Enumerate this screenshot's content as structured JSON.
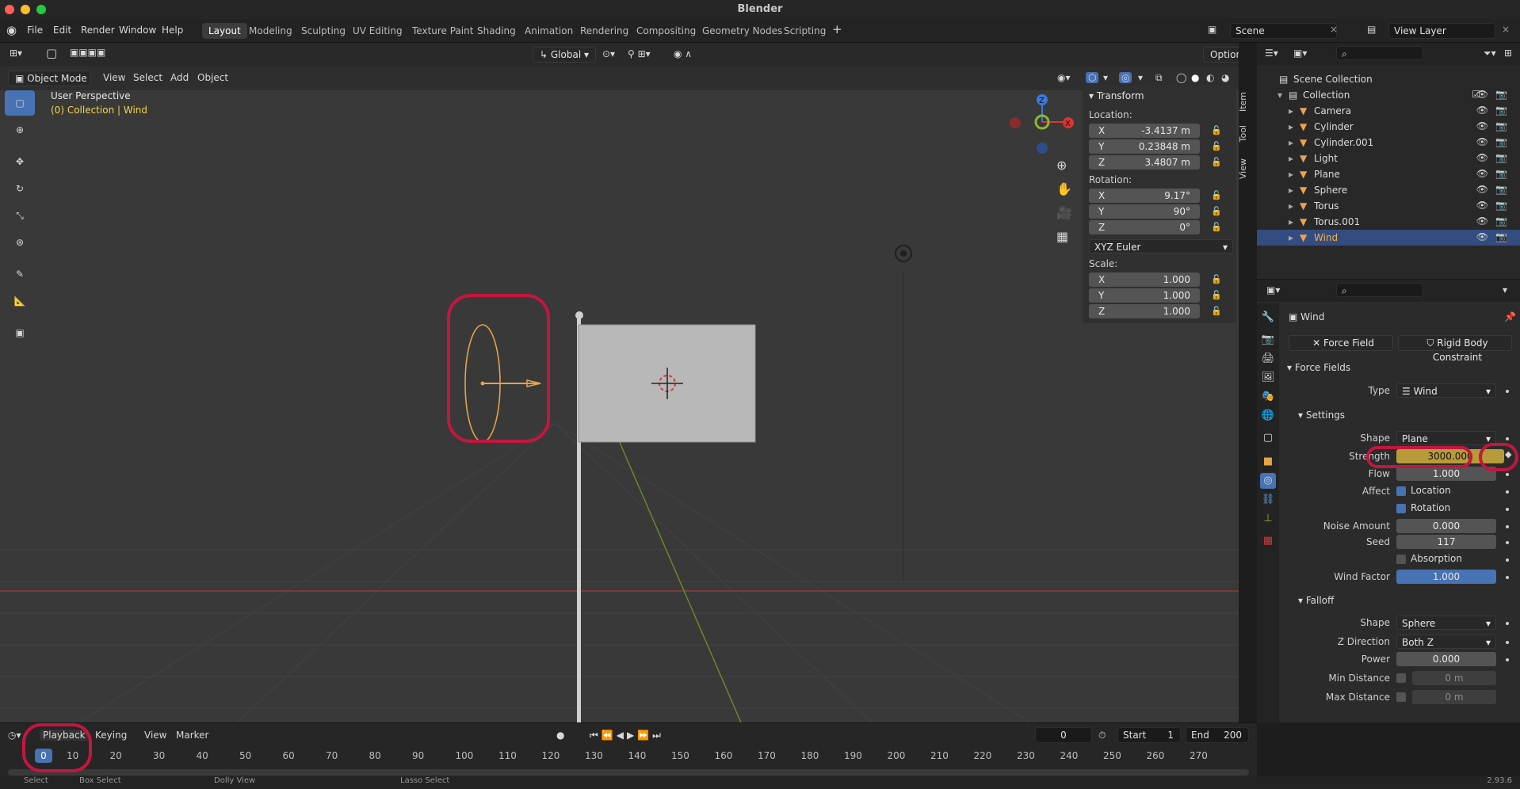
{
  "window": {
    "title": "Blender"
  },
  "menu": [
    "File",
    "Edit",
    "Render",
    "Window",
    "Help"
  ],
  "workspaces": [
    {
      "label": "Layout",
      "active": true
    },
    {
      "label": "Modeling",
      "active": false
    },
    {
      "label": "Sculpting",
      "active": false
    },
    {
      "label": "UV Editing",
      "active": false
    },
    {
      "label": "Texture Paint",
      "active": false
    },
    {
      "label": "Shading",
      "active": false
    },
    {
      "label": "Animation",
      "active": false
    },
    {
      "label": "Rendering",
      "active": false
    },
    {
      "label": "Compositing",
      "active": false
    },
    {
      "label": "Geometry Nodes",
      "active": false
    },
    {
      "label": "Scripting",
      "active": false
    }
  ],
  "scene": {
    "name": "Scene",
    "view_layer": "View Layer"
  },
  "viewport": {
    "mode": "Object Mode",
    "menus": [
      "View",
      "Select",
      "Add",
      "Object"
    ],
    "transform_orientation": "Global",
    "options": "Options",
    "perspective": "User Perspective",
    "collection_info": "(0) Collection | Wind"
  },
  "npanel": {
    "title": "Transform",
    "location_label": "Location:",
    "location": [
      {
        "axis": "X",
        "value": "-3.4137 m"
      },
      {
        "axis": "Y",
        "value": "0.23848 m"
      },
      {
        "axis": "Z",
        "value": "3.4807 m"
      }
    ],
    "rotation_label": "Rotation:",
    "rotation": [
      {
        "axis": "X",
        "value": "9.17°"
      },
      {
        "axis": "Y",
        "value": "90°"
      },
      {
        "axis": "Z",
        "value": "0°"
      }
    ],
    "rotation_mode": "XYZ Euler",
    "scale_label": "Scale:",
    "scale": [
      {
        "axis": "X",
        "value": "1.000"
      },
      {
        "axis": "Y",
        "value": "1.000"
      },
      {
        "axis": "Z",
        "value": "1.000"
      }
    ],
    "tabs": [
      "Item",
      "Tool",
      "View"
    ]
  },
  "outliner": {
    "scene_collection": "Scene Collection",
    "collection": "Collection",
    "items": [
      {
        "name": "Camera",
        "color": "#e3a35a",
        "selected": false
      },
      {
        "name": "Cylinder",
        "color": "#f0a24a",
        "selected": false
      },
      {
        "name": "Cylinder.001",
        "color": "#f0a24a",
        "selected": false
      },
      {
        "name": "Light",
        "color": "#e3a35a",
        "selected": false
      },
      {
        "name": "Plane",
        "color": "#f0a24a",
        "selected": false
      },
      {
        "name": "Sphere",
        "color": "#f0a24a",
        "selected": false
      },
      {
        "name": "Torus",
        "color": "#f0a24a",
        "selected": false
      },
      {
        "name": "Torus.001",
        "color": "#f0a24a",
        "selected": false
      },
      {
        "name": "Wind",
        "color": "#f0a24a",
        "selected": true
      }
    ]
  },
  "properties": {
    "object_name": "Wind",
    "force_field_btn": "Force Field",
    "rigid_body_btn": "Rigid Body Constraint",
    "force_fields_header": "Force Fields",
    "type_label": "Type",
    "type_value": "Wind",
    "settings_header": "Settings",
    "shape_label": "Shape",
    "shape_value": "Plane",
    "strength_label": "Strength",
    "strength_value": "3000.000",
    "flow_label": "Flow",
    "flow_value": "1.000",
    "affect_label": "Affect",
    "affect_location": "Location",
    "affect_rotation": "Rotation",
    "noise_label": "Noise Amount",
    "noise_value": "0.000",
    "seed_label": "Seed",
    "seed_value": "117",
    "absorption": "Absorption",
    "wind_factor_label": "Wind Factor",
    "wind_factor_value": "1.000",
    "falloff_header": "Falloff",
    "falloff_shape_label": "Shape",
    "falloff_shape_value": "Sphere",
    "zdir_label": "Z Direction",
    "zdir_value": "Both Z",
    "power_label": "Power",
    "power_value": "0.000",
    "min_dist_label": "Min Distance",
    "min_dist_value": "0 m",
    "max_dist_label": "Max Distance",
    "max_dist_value": "0 m"
  },
  "timeline": {
    "menus": [
      "Playback",
      "Keying",
      "View",
      "Marker"
    ],
    "current_frame": "0",
    "start_label": "Start",
    "start_value": "1",
    "end_label": "End",
    "end_value": "200",
    "ticks": [
      "10",
      "20",
      "30",
      "40",
      "50",
      "60",
      "70",
      "80",
      "90",
      "100",
      "110",
      "120",
      "130",
      "140",
      "150",
      "160",
      "170",
      "180",
      "190",
      "200",
      "210",
      "220",
      "230",
      "240",
      "250",
      "260",
      "270"
    ],
    "playhead": "0"
  },
  "statusbar": {
    "select": "Select",
    "box_select": "Box Select",
    "dolly": "Dolly View",
    "lasso": "Lasso Select",
    "version": "2.93.6"
  },
  "colors": {
    "accent": "#4772b3",
    "keyframed": "#b79a3a",
    "annotation": "#c4163e",
    "selected_row": "#334d80"
  }
}
